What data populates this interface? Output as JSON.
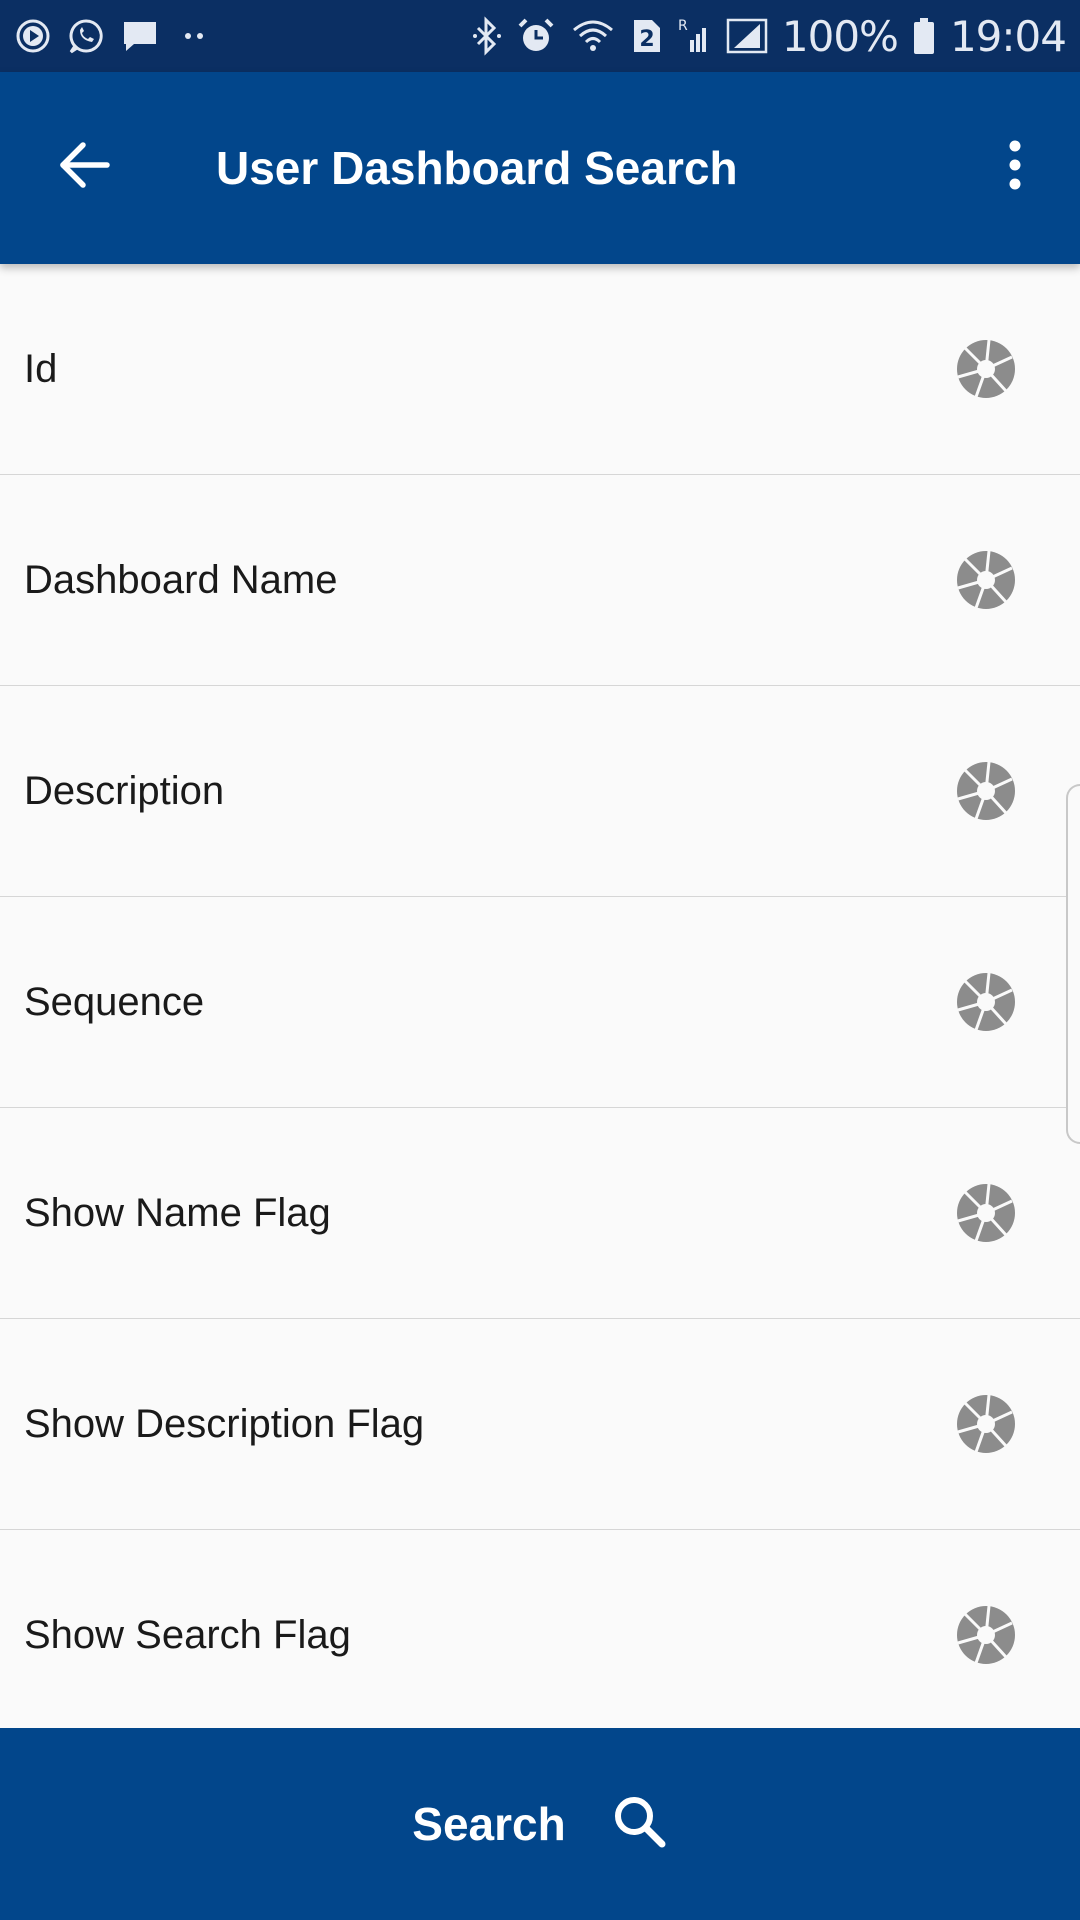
{
  "status_bar": {
    "battery_percent": "100%",
    "time": "19:04",
    "sim_slot": "2",
    "roaming_indicator": "R",
    "icons_left": [
      "media-play-icon",
      "whatsapp-icon",
      "message-icon",
      "more-dots-icon"
    ],
    "icons_right": [
      "bluetooth-icon",
      "alarm-icon",
      "wifi-icon",
      "sim-icon",
      "signal-roaming-icon",
      "signal-icon",
      "battery-icon"
    ]
  },
  "app_bar": {
    "title": "User Dashboard Search",
    "back_icon": "arrow-left-icon",
    "menu_icon": "overflow-menu-icon"
  },
  "fields": [
    {
      "label": "Id",
      "icon": "aperture-icon"
    },
    {
      "label": "Dashboard Name",
      "icon": "aperture-icon"
    },
    {
      "label": "Description",
      "icon": "aperture-icon"
    },
    {
      "label": "Sequence",
      "icon": "aperture-icon"
    },
    {
      "label": "Show Name Flag",
      "icon": "aperture-icon"
    },
    {
      "label": "Show Description Flag",
      "icon": "aperture-icon"
    },
    {
      "label": "Show Search Flag",
      "icon": "aperture-icon"
    }
  ],
  "bottom_bar": {
    "search_label": "Search",
    "search_icon": "magnifier-icon"
  },
  "colors": {
    "status_bar": "#0b2f63",
    "primary": "#02468b",
    "background": "#fafafa",
    "divider": "#d6d6d6",
    "icon_gray": "#8c8c8c"
  }
}
